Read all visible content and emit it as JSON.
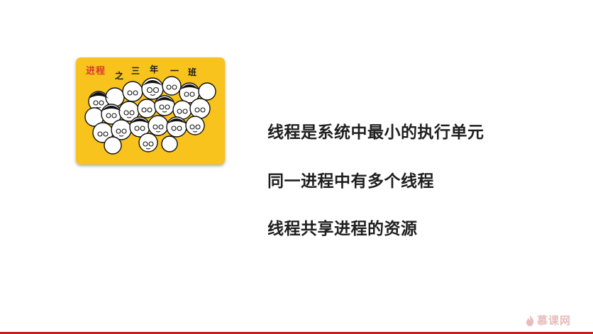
{
  "card": {
    "title": "进程",
    "subtitle_chars": [
      "之",
      "三",
      "年",
      "一",
      "班"
    ],
    "background_color": "#f8c31c",
    "title_color": "#d93b2a"
  },
  "bullets": [
    "线程是系统中最小的执行单元",
    "同一进程中有多个线程",
    "线程共享进程的资源"
  ],
  "logo": {
    "text": "慕课网",
    "icon": "flame-icon",
    "color": "#e8bcbc"
  },
  "accent_bar_color": "#c51d1d"
}
